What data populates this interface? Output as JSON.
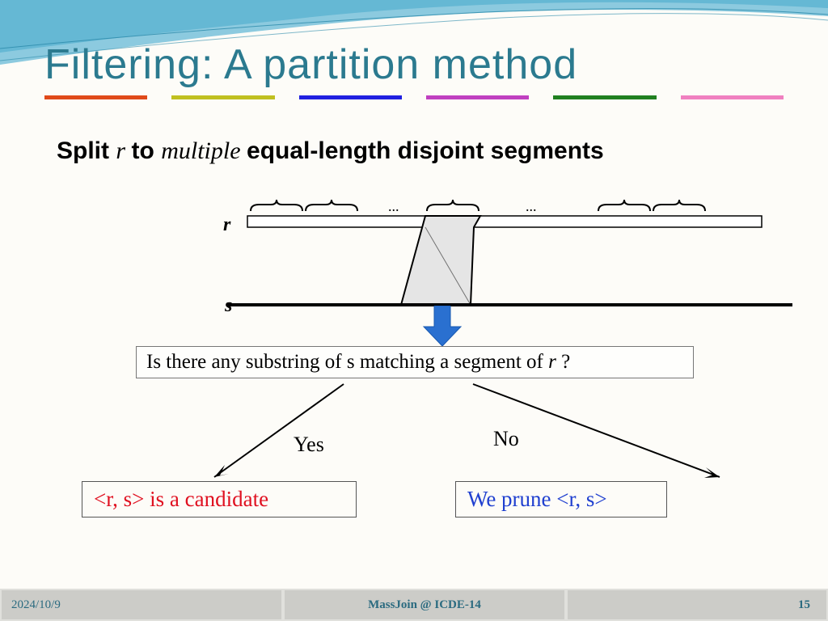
{
  "title": "Filtering: A partition method",
  "subtitle": {
    "split": "Split ",
    "r": " r ",
    "to": "to ",
    "multiple": "multiple ",
    "rest": "equal-length disjoint  segments"
  },
  "diagram": {
    "r_label": "r",
    "s_label": "s"
  },
  "question": {
    "text": "Is there any substring of s matching a segment of ",
    "r": "r ",
    "qmark": "?"
  },
  "branches": {
    "yes": "Yes",
    "no": "No"
  },
  "outcomes": {
    "candidate": "<r, s> is a  candidate",
    "prune": "We prune <r, s>"
  },
  "footer": {
    "date": "2024/10/9",
    "venue": "MassJoin @ ICDE-14",
    "page": "15"
  },
  "accent_colors": [
    "#e04a1a",
    "#c0c020",
    "#2020e0",
    "#c040c0",
    "#208020",
    "#f080c0"
  ]
}
